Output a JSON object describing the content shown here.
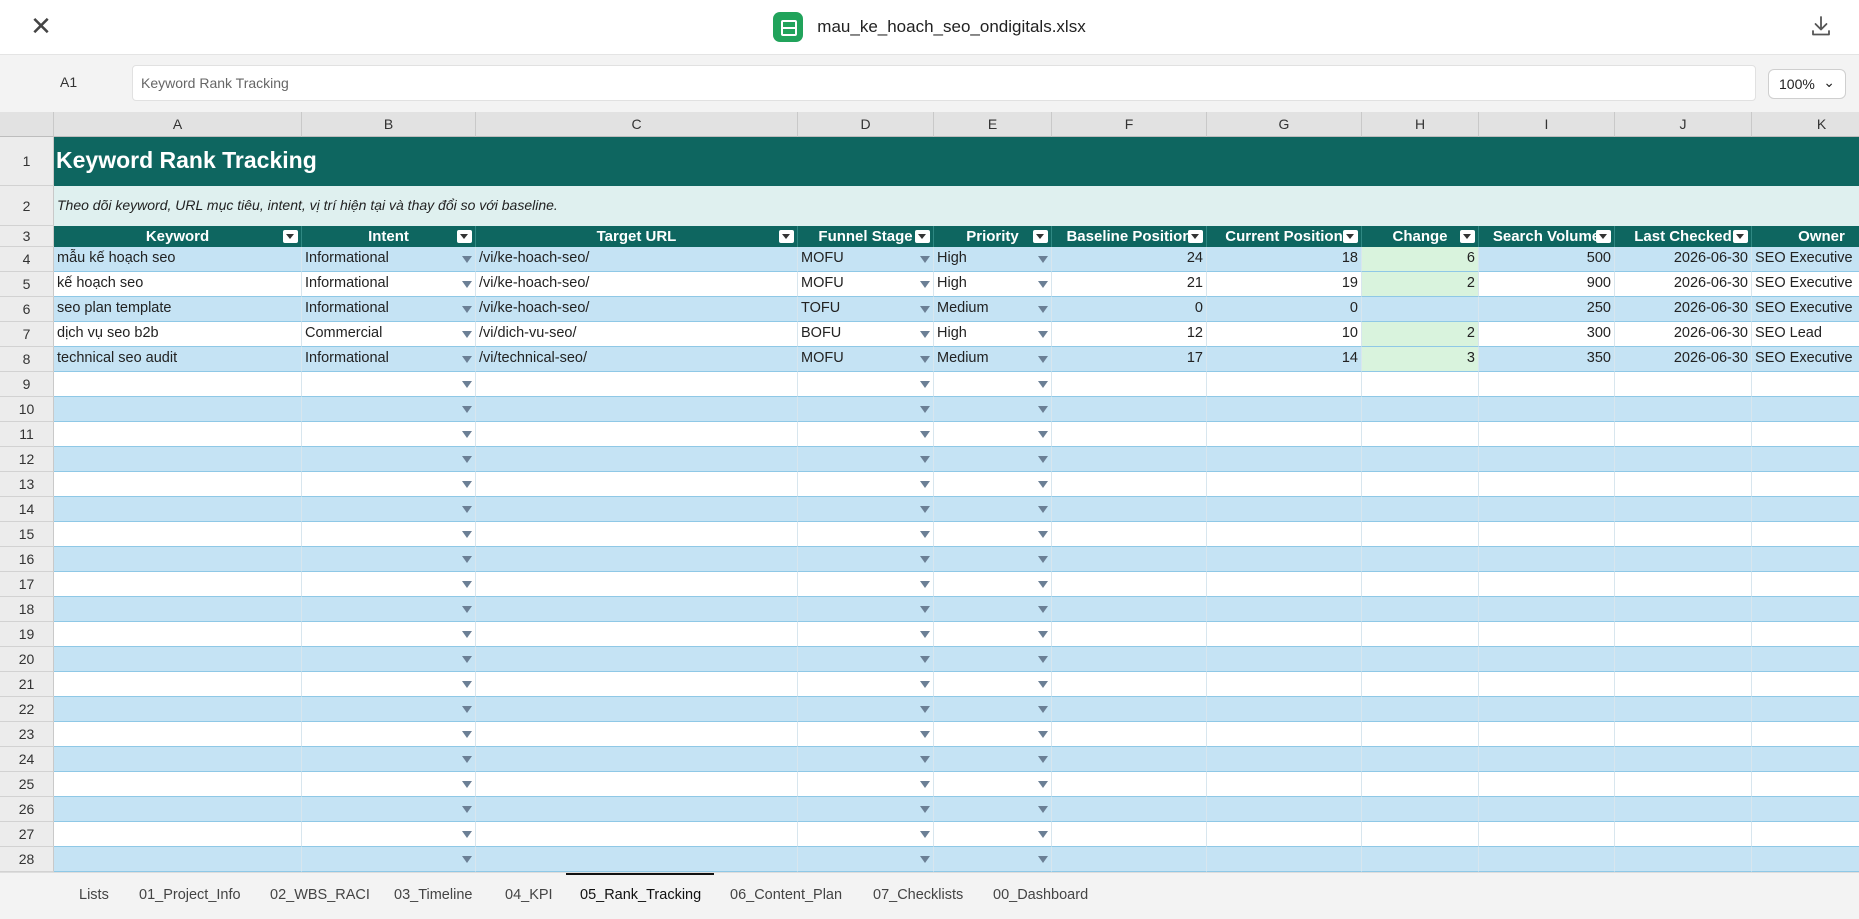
{
  "window": {
    "file_name": "mau_ke_hoach_seo_ondigitals.xlsx",
    "close_icon": "close-icon",
    "download_icon": "download-icon",
    "file_icon": "spreadsheet-icon"
  },
  "formula_bar": {
    "cell_ref": "A1",
    "value": "Keyword Rank Tracking",
    "zoom": "100%"
  },
  "columns": [
    "A",
    "B",
    "C",
    "D",
    "E",
    "F",
    "G",
    "H",
    "I",
    "J",
    "K"
  ],
  "rows": [
    "1",
    "2",
    "3",
    "4",
    "5",
    "6",
    "7",
    "8",
    "9",
    "10",
    "11",
    "12",
    "13",
    "14",
    "15",
    "16",
    "17",
    "18",
    "19",
    "20",
    "21",
    "22",
    "23",
    "24",
    "25",
    "26",
    "27",
    "28"
  ],
  "sheet": {
    "title": "Keyword Rank Tracking",
    "subtitle": "Theo dõi keyword, URL mục tiêu, intent, vị trí hiện tại và thay đổi so với baseline.",
    "headers": [
      "Keyword",
      "Intent",
      "Target URL",
      "Funnel Stage",
      "Priority",
      "Baseline Position",
      "Current Position",
      "Change",
      "Search Volume",
      "Last Checked",
      "Owner"
    ],
    "data": [
      [
        "mẫu kế hoạch seo",
        "Informational",
        "/vi/ke-hoach-seo/",
        "MOFU",
        "High",
        "24",
        "18",
        "6",
        "500",
        "2026-06-30",
        "SEO Executive"
      ],
      [
        "kế hoạch seo",
        "Informational",
        "/vi/ke-hoach-seo/",
        "MOFU",
        "High",
        "21",
        "19",
        "2",
        "900",
        "2026-06-30",
        "SEO Executive"
      ],
      [
        "seo plan template",
        "Informational",
        "/vi/ke-hoach-seo/",
        "TOFU",
        "Medium",
        "0",
        "0",
        "",
        "250",
        "2026-06-30",
        "SEO Executive"
      ],
      [
        "dịch vụ seo b2b",
        "Commercial",
        "/vi/dich-vu-seo/",
        "BOFU",
        "High",
        "12",
        "10",
        "2",
        "300",
        "2026-06-30",
        "SEO Lead"
      ],
      [
        "technical seo audit",
        "Informational",
        "/vi/technical-seo/",
        "MOFU",
        "Medium",
        "17",
        "14",
        "3",
        "350",
        "2026-06-30",
        "SEO Executive"
      ]
    ]
  },
  "tabs": [
    "Lists",
    "01_Project_Info",
    "02_WBS_RACI",
    "03_Timeline",
    "04_KPI",
    "05_Rank_Tracking",
    "06_Content_Plan",
    "07_Checklists",
    "00_Dashboard"
  ],
  "active_tab": "05_Rank_Tracking",
  "colors": {
    "header_fill": "#0e6660",
    "subtitle_fill": "#dff0ef",
    "band_row": "#c5e3f4",
    "change_highlight": "#d9f3dd",
    "file_icon_green": "#21a35b"
  }
}
